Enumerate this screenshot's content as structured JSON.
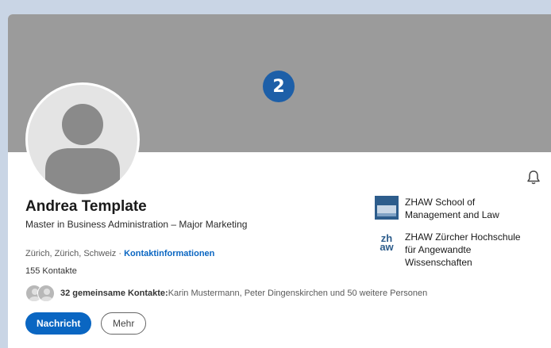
{
  "cover": {
    "badge_number": "2"
  },
  "profile": {
    "name": "Andrea Template",
    "headline": "Master in Business Administration – Major Marketing",
    "location": "Zürich, Zürich, Schweiz · ",
    "contact_link": "Kontaktinformationen",
    "connections": "155 Kontakte",
    "mutual_count": "32 gemeinsame Kontakte:",
    "mutual_names": " Karin Mustermann, Peter Dingenskirchen und 50 weitere Personen"
  },
  "actions": {
    "message_label": "Nachricht",
    "more_label": "Mehr"
  },
  "education": [
    {
      "name": "ZHAW School of Management and Law",
      "logo": "sml-logo"
    },
    {
      "name": "ZHAW Zürcher Hochschule für Angewandte Wissenschaften",
      "logo_text": "zh aw",
      "logo": "zhaw-logo"
    }
  ],
  "colors": {
    "accent": "#0a66c2",
    "cover": "#9b9b9b",
    "badge": "#1d5fa8",
    "page_bg": "#c9d5e5"
  },
  "icons": {
    "notifications": "bell-icon"
  }
}
